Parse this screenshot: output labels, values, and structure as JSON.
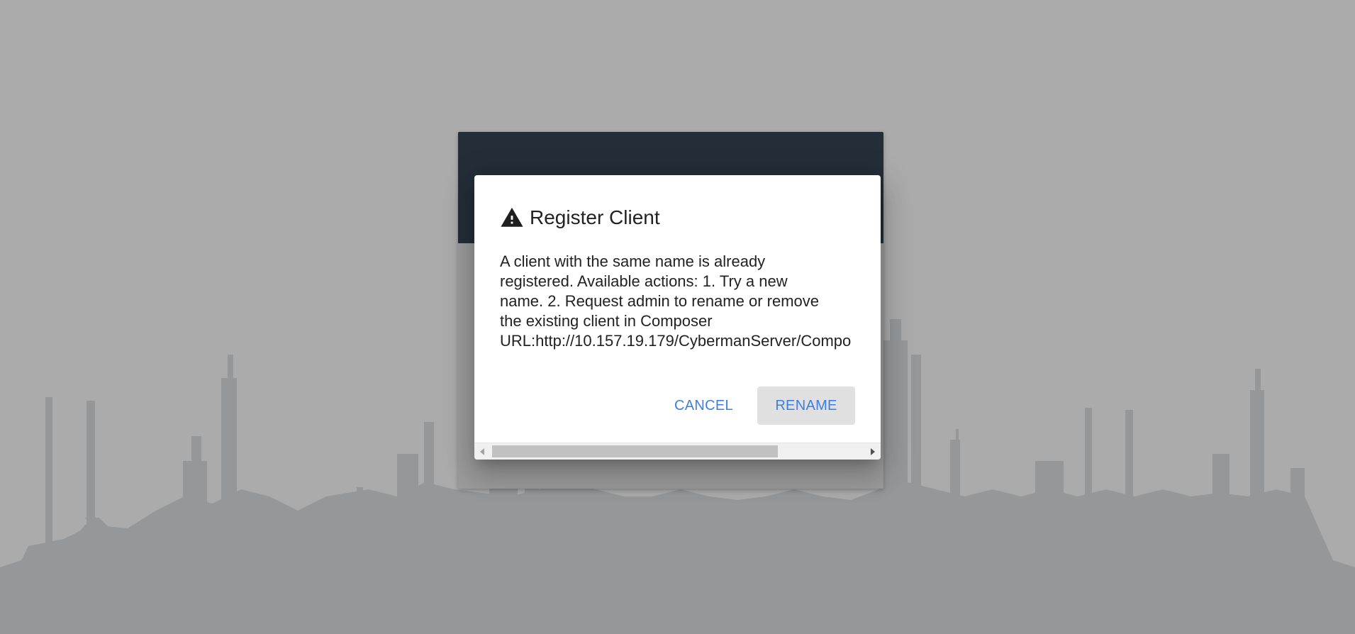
{
  "dialog": {
    "title": "Register Client",
    "icon": "warning-icon",
    "message_lines": [
      "A client with the same name is already",
      "registered. Available actions: 1. Try a new",
      "name. 2. Request admin to rename or remove",
      "the existing client in Composer",
      "URL:http://10.157.19.179/CybermanServer/Compo"
    ],
    "buttons": {
      "cancel_label": "CANCEL",
      "rename_label": "RENAME"
    }
  },
  "colors": {
    "page_background": "#ababab",
    "skyline": "#959799",
    "card_header": "#242e38",
    "button_text": "#3d7fe0",
    "rename_button_bg": "#e0e0e0"
  }
}
